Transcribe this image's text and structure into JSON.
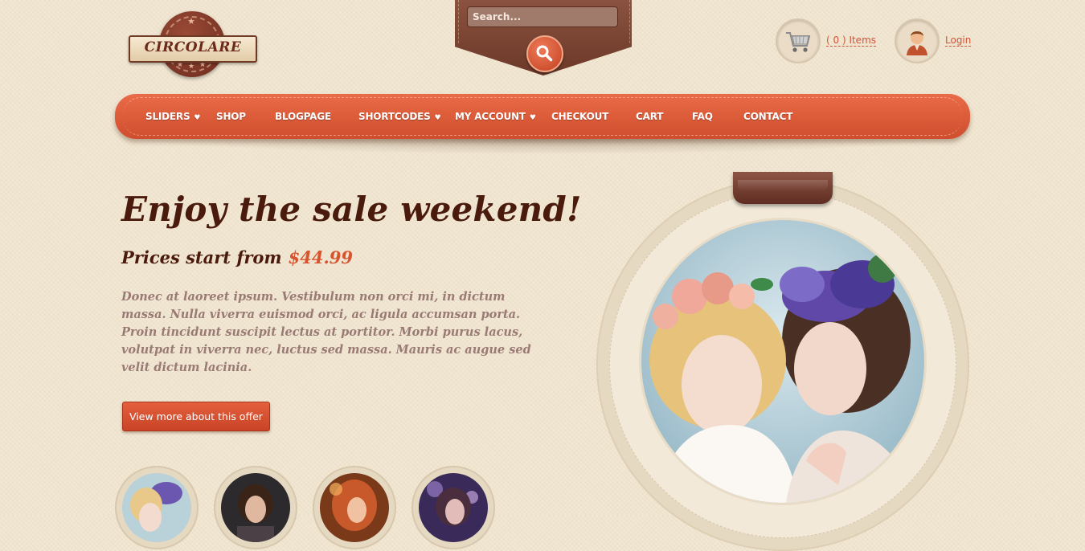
{
  "logo": {
    "text": "CIRCOLARE"
  },
  "search": {
    "placeholder": "Search..."
  },
  "cart": {
    "label": "( 0 ) Items"
  },
  "login": {
    "label": "Login"
  },
  "nav": {
    "items": [
      {
        "label": "SLIDERS",
        "has_dropdown": true
      },
      {
        "label": "SHOP",
        "has_dropdown": false
      },
      {
        "label": "BLOGPAGE",
        "has_dropdown": false
      },
      {
        "label": "SHORTCODES",
        "has_dropdown": true
      },
      {
        "label": "MY ACCOUNT",
        "has_dropdown": true
      },
      {
        "label": "CHECKOUT",
        "has_dropdown": false
      },
      {
        "label": "CART",
        "has_dropdown": false
      },
      {
        "label": "FAQ",
        "has_dropdown": false
      },
      {
        "label": "CONTACT",
        "has_dropdown": false
      }
    ]
  },
  "hero": {
    "title": "Enjoy the sale weekend!",
    "prices_label": "Prices start from",
    "price": "$44.99",
    "body": "Donec at laoreet ipsum. Vestibulum non orci mi, in dictum massa. Nulla viverra euismod orci, ac ligula accumsan porta. Proin tincidunt suscipit lectus at portitor. Morbi purus lacus, volutpat in viverra nec, luctus sed massa. Mauris ac augue sed velit dictum lacinia.",
    "button": "View more about this offer"
  },
  "colors": {
    "accent": "#d8542f",
    "nav_bg": "#e0603d",
    "heading": "#4a1a0c",
    "body_text": "#9a7a74",
    "background": "#f1e7d3",
    "leather": "#6c3828"
  },
  "icons": {
    "search": "magnifier-icon",
    "cart": "shopping-cart-icon",
    "login": "user-avatar-icon",
    "dropdown": "heart-caret-icon"
  }
}
